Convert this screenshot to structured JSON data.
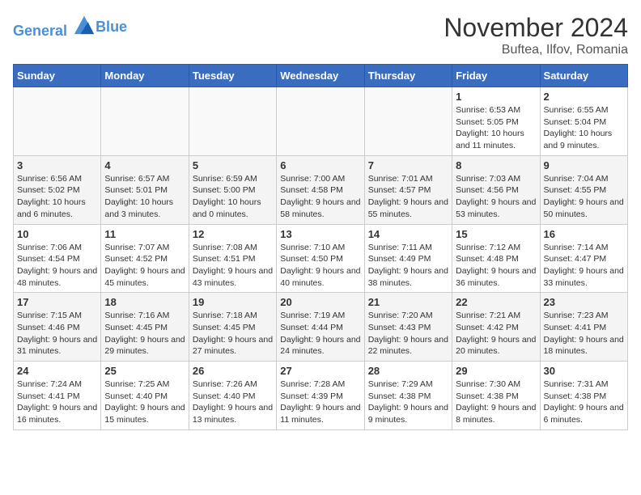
{
  "header": {
    "logo_line1": "General",
    "logo_line2": "Blue",
    "month": "November 2024",
    "location": "Buftea, Ilfov, Romania"
  },
  "days_of_week": [
    "Sunday",
    "Monday",
    "Tuesday",
    "Wednesday",
    "Thursday",
    "Friday",
    "Saturday"
  ],
  "weeks": [
    [
      {
        "num": "",
        "info": ""
      },
      {
        "num": "",
        "info": ""
      },
      {
        "num": "",
        "info": ""
      },
      {
        "num": "",
        "info": ""
      },
      {
        "num": "",
        "info": ""
      },
      {
        "num": "1",
        "info": "Sunrise: 6:53 AM\nSunset: 5:05 PM\nDaylight: 10 hours and 11 minutes."
      },
      {
        "num": "2",
        "info": "Sunrise: 6:55 AM\nSunset: 5:04 PM\nDaylight: 10 hours and 9 minutes."
      }
    ],
    [
      {
        "num": "3",
        "info": "Sunrise: 6:56 AM\nSunset: 5:02 PM\nDaylight: 10 hours and 6 minutes."
      },
      {
        "num": "4",
        "info": "Sunrise: 6:57 AM\nSunset: 5:01 PM\nDaylight: 10 hours and 3 minutes."
      },
      {
        "num": "5",
        "info": "Sunrise: 6:59 AM\nSunset: 5:00 PM\nDaylight: 10 hours and 0 minutes."
      },
      {
        "num": "6",
        "info": "Sunrise: 7:00 AM\nSunset: 4:58 PM\nDaylight: 9 hours and 58 minutes."
      },
      {
        "num": "7",
        "info": "Sunrise: 7:01 AM\nSunset: 4:57 PM\nDaylight: 9 hours and 55 minutes."
      },
      {
        "num": "8",
        "info": "Sunrise: 7:03 AM\nSunset: 4:56 PM\nDaylight: 9 hours and 53 minutes."
      },
      {
        "num": "9",
        "info": "Sunrise: 7:04 AM\nSunset: 4:55 PM\nDaylight: 9 hours and 50 minutes."
      }
    ],
    [
      {
        "num": "10",
        "info": "Sunrise: 7:06 AM\nSunset: 4:54 PM\nDaylight: 9 hours and 48 minutes."
      },
      {
        "num": "11",
        "info": "Sunrise: 7:07 AM\nSunset: 4:52 PM\nDaylight: 9 hours and 45 minutes."
      },
      {
        "num": "12",
        "info": "Sunrise: 7:08 AM\nSunset: 4:51 PM\nDaylight: 9 hours and 43 minutes."
      },
      {
        "num": "13",
        "info": "Sunrise: 7:10 AM\nSunset: 4:50 PM\nDaylight: 9 hours and 40 minutes."
      },
      {
        "num": "14",
        "info": "Sunrise: 7:11 AM\nSunset: 4:49 PM\nDaylight: 9 hours and 38 minutes."
      },
      {
        "num": "15",
        "info": "Sunrise: 7:12 AM\nSunset: 4:48 PM\nDaylight: 9 hours and 36 minutes."
      },
      {
        "num": "16",
        "info": "Sunrise: 7:14 AM\nSunset: 4:47 PM\nDaylight: 9 hours and 33 minutes."
      }
    ],
    [
      {
        "num": "17",
        "info": "Sunrise: 7:15 AM\nSunset: 4:46 PM\nDaylight: 9 hours and 31 minutes."
      },
      {
        "num": "18",
        "info": "Sunrise: 7:16 AM\nSunset: 4:45 PM\nDaylight: 9 hours and 29 minutes."
      },
      {
        "num": "19",
        "info": "Sunrise: 7:18 AM\nSunset: 4:45 PM\nDaylight: 9 hours and 27 minutes."
      },
      {
        "num": "20",
        "info": "Sunrise: 7:19 AM\nSunset: 4:44 PM\nDaylight: 9 hours and 24 minutes."
      },
      {
        "num": "21",
        "info": "Sunrise: 7:20 AM\nSunset: 4:43 PM\nDaylight: 9 hours and 22 minutes."
      },
      {
        "num": "22",
        "info": "Sunrise: 7:21 AM\nSunset: 4:42 PM\nDaylight: 9 hours and 20 minutes."
      },
      {
        "num": "23",
        "info": "Sunrise: 7:23 AM\nSunset: 4:41 PM\nDaylight: 9 hours and 18 minutes."
      }
    ],
    [
      {
        "num": "24",
        "info": "Sunrise: 7:24 AM\nSunset: 4:41 PM\nDaylight: 9 hours and 16 minutes."
      },
      {
        "num": "25",
        "info": "Sunrise: 7:25 AM\nSunset: 4:40 PM\nDaylight: 9 hours and 15 minutes."
      },
      {
        "num": "26",
        "info": "Sunrise: 7:26 AM\nSunset: 4:40 PM\nDaylight: 9 hours and 13 minutes."
      },
      {
        "num": "27",
        "info": "Sunrise: 7:28 AM\nSunset: 4:39 PM\nDaylight: 9 hours and 11 minutes."
      },
      {
        "num": "28",
        "info": "Sunrise: 7:29 AM\nSunset: 4:38 PM\nDaylight: 9 hours and 9 minutes."
      },
      {
        "num": "29",
        "info": "Sunrise: 7:30 AM\nSunset: 4:38 PM\nDaylight: 9 hours and 8 minutes."
      },
      {
        "num": "30",
        "info": "Sunrise: 7:31 AM\nSunset: 4:38 PM\nDaylight: 9 hours and 6 minutes."
      }
    ]
  ]
}
